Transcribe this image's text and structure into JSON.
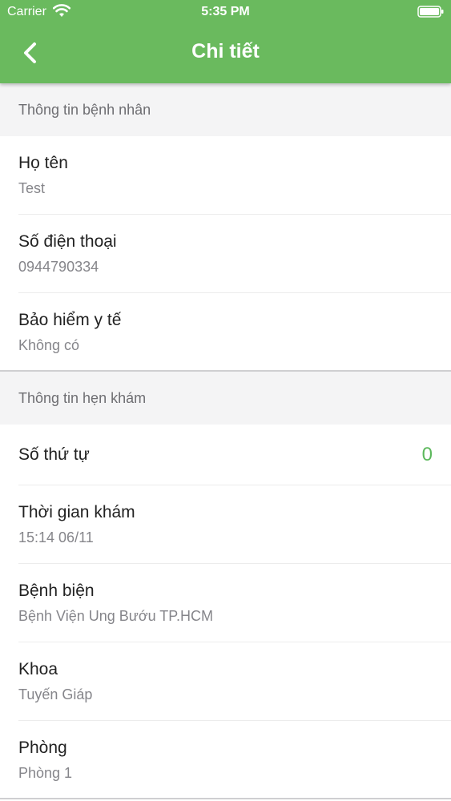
{
  "status_bar": {
    "carrier": "Carrier",
    "time": "5:35 PM"
  },
  "header": {
    "title": "Chi tiết"
  },
  "patient_section": {
    "title": "Thông tin bệnh nhân",
    "name": {
      "label": "Họ tên",
      "value": "Test"
    },
    "phone": {
      "label": "Số điện thoại",
      "value": "0944790334"
    },
    "insurance": {
      "label": "Bảo hiểm y tế",
      "value": "Không có"
    }
  },
  "appointment_section": {
    "title": "Thông tin hẹn khám",
    "queue_number": {
      "label": "Số thứ tự",
      "value": "0"
    },
    "exam_time": {
      "label": "Thời gian khám",
      "value": "15:14 06/11"
    },
    "hospital": {
      "label": "Bệnh biện",
      "value": "Bệnh Viện Ung Bướu TP.HCM"
    },
    "department": {
      "label": "Khoa",
      "value": "Tuyến Giáp"
    },
    "room": {
      "label": "Phòng",
      "value": "Phòng 1"
    }
  },
  "colors": {
    "header_bg": "#6aba5e",
    "accent": "#5cb85c"
  }
}
